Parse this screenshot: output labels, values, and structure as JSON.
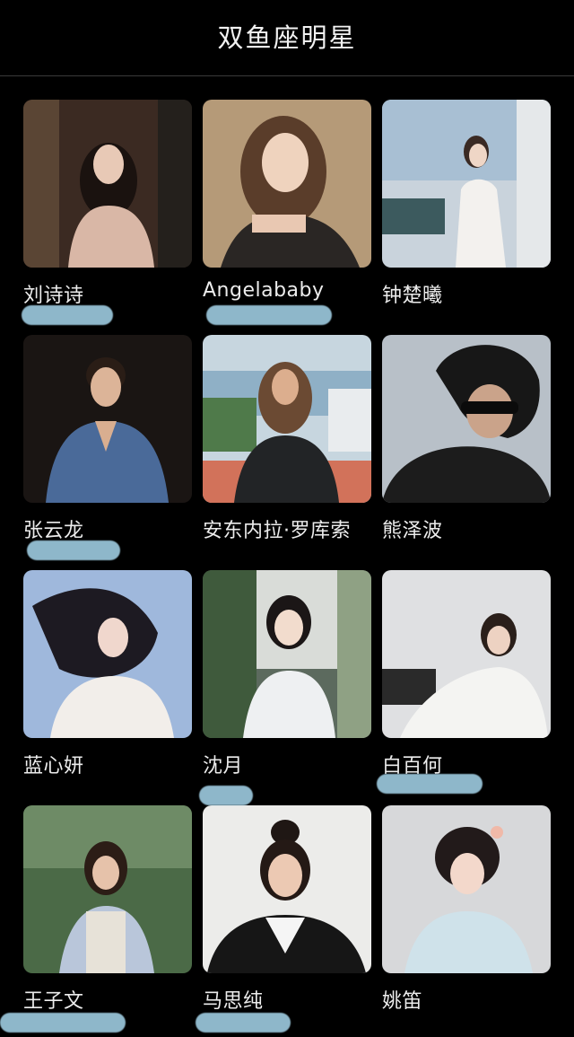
{
  "title": "双鱼座明星",
  "colors": {
    "background": "#000000",
    "text": "#ececec",
    "redaction": "#9ecbe0",
    "divider": "#3a3a3a"
  },
  "stars": [
    {
      "name": "刘诗诗"
    },
    {
      "name": "Angelababy"
    },
    {
      "name": "钟楚曦"
    },
    {
      "name": "张云龙"
    },
    {
      "name": "安东内拉·罗库索"
    },
    {
      "name": "熊泽波"
    },
    {
      "name": "蓝心妍"
    },
    {
      "name": "沈月"
    },
    {
      "name": "白百何"
    },
    {
      "name": "王子文"
    },
    {
      "name": "马思纯"
    },
    {
      "name": "姚笛"
    }
  ]
}
